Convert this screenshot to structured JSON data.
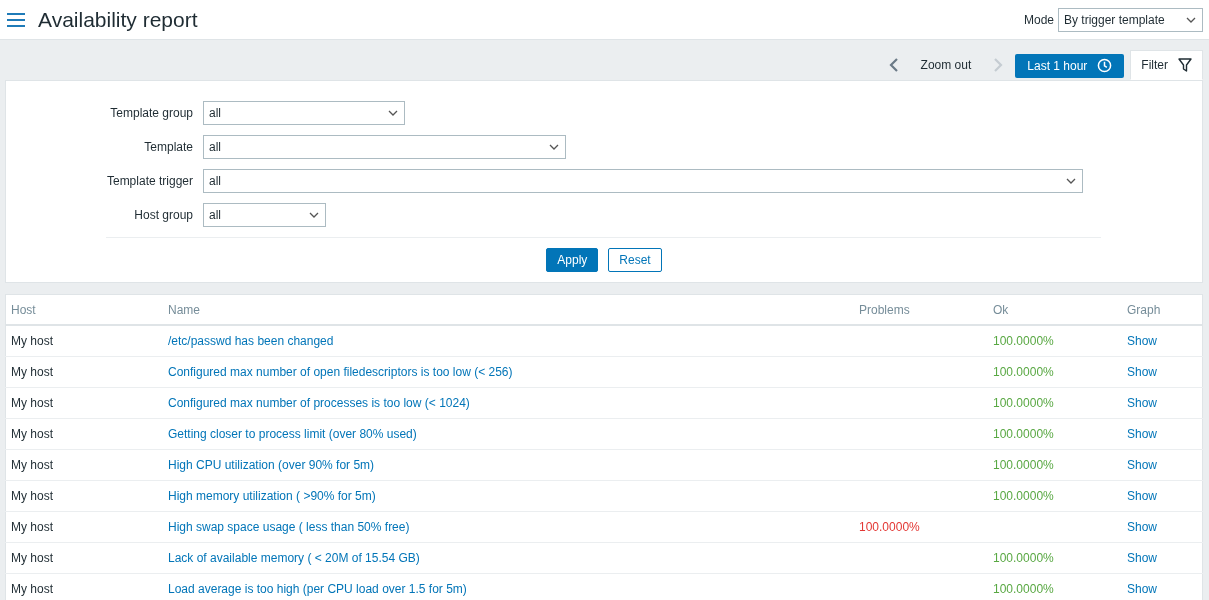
{
  "page": {
    "title": "Availability report"
  },
  "mode": {
    "label": "Mode",
    "value": "By trigger template"
  },
  "timebar": {
    "zoom_out": "Zoom out",
    "prev_disabled": false,
    "next_disabled": true
  },
  "time_button": "Last 1 hour",
  "filter_tab": {
    "label": "Filter",
    "selected": true
  },
  "filter": {
    "fields": [
      {
        "label": "Template group",
        "value": "all"
      },
      {
        "label": "Template",
        "value": "all"
      },
      {
        "label": "Template trigger",
        "value": "all"
      },
      {
        "label": "Host group",
        "value": "all"
      }
    ],
    "buttons": [
      {
        "label": "Apply",
        "kind": "primary"
      },
      {
        "label": "Reset",
        "kind": "secondary"
      }
    ]
  },
  "table": {
    "columns": [
      "Host",
      "Name",
      "Problems",
      "Ok",
      "Graph"
    ],
    "rows": [
      {
        "host": "My host",
        "name": "/etc/passwd has been changed",
        "problems": "",
        "ok": "100.0000%",
        "graph": "Show"
      },
      {
        "host": "My host",
        "name": "Configured max number of open filedescriptors is too low (< 256)",
        "problems": "",
        "ok": "100.0000%",
        "graph": "Show"
      },
      {
        "host": "My host",
        "name": "Configured max number of processes is too low (< 1024)",
        "problems": "",
        "ok": "100.0000%",
        "graph": "Show"
      },
      {
        "host": "My host",
        "name": "Getting closer to process limit (over 80% used)",
        "problems": "",
        "ok": "100.0000%",
        "graph": "Show"
      },
      {
        "host": "My host",
        "name": "High CPU utilization (over 90% for 5m)",
        "problems": "",
        "ok": "100.0000%",
        "graph": "Show"
      },
      {
        "host": "My host",
        "name": "High memory utilization ( >90% for 5m)",
        "problems": "",
        "ok": "100.0000%",
        "graph": "Show"
      },
      {
        "host": "My host",
        "name": "High swap space usage ( less than 50% free)",
        "problems": "100.0000%",
        "ok": "",
        "graph": "Show"
      },
      {
        "host": "My host",
        "name": "Lack of available memory ( < 20M of 15.54 GB)",
        "problems": "",
        "ok": "100.0000%",
        "graph": "Show"
      },
      {
        "host": "My host",
        "name": "Load average is too high (per CPU load over 1.5 for 5m)",
        "problems": "",
        "ok": "100.0000%",
        "graph": "Show"
      }
    ]
  }
}
